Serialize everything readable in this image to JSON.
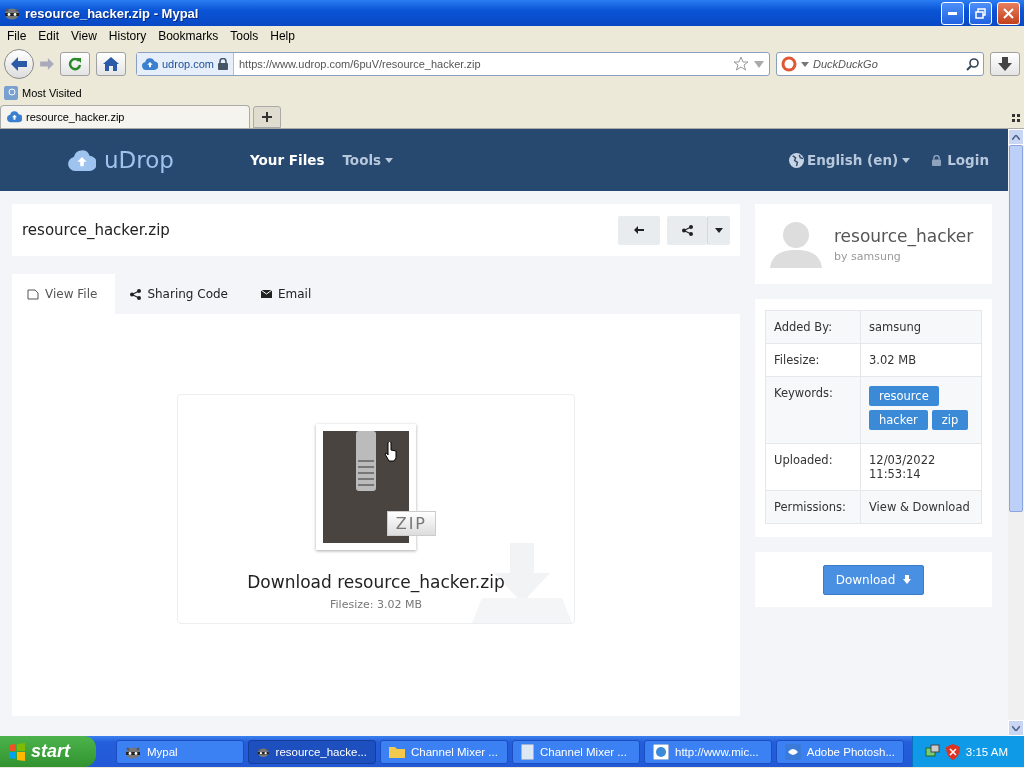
{
  "window": {
    "title": "resource_hacker.zip - Mypal"
  },
  "menu": [
    "File",
    "Edit",
    "View",
    "History",
    "Bookmarks",
    "Tools",
    "Help"
  ],
  "toolbar": {
    "site_identity": "udrop.com",
    "url": "https://www.udrop.com/6puV/resource_hacker.zip",
    "search": {
      "placeholder": "DuckDuckGo"
    }
  },
  "bookmarks": [
    "Most Visited"
  ],
  "tabs": [
    {
      "label": "resource_hacker.zip",
      "selected": true
    }
  ],
  "site_nav": {
    "logo": "uDrop",
    "items": [
      {
        "label": "Your Files",
        "selected": true,
        "dropdown": false
      },
      {
        "label": "Tools",
        "selected": false,
        "dropdown": true
      }
    ],
    "language": "English (en)",
    "login": "Login"
  },
  "file": {
    "title": "resource_hacker.zip",
    "tabs": [
      {
        "label": "View File",
        "kind": "view",
        "selected": true
      },
      {
        "label": "Sharing Code",
        "kind": "share",
        "selected": false
      },
      {
        "label": "Email",
        "kind": "email",
        "selected": false
      }
    ],
    "badge": "ZIP",
    "download_title": "Download resource_hacker.zip",
    "filesize": "Filesize: 3.02 MB"
  },
  "owner": {
    "name": "resource_hacker",
    "by": "by samsung"
  },
  "details": [
    {
      "label": "Added By:",
      "kind": "text",
      "value": "samsung"
    },
    {
      "label": "Filesize:",
      "kind": "text",
      "value": "3.02 MB"
    },
    {
      "label": "Keywords:",
      "kind": "tags",
      "tags": [
        "resource",
        "hacker",
        "zip"
      ]
    },
    {
      "label": "Uploaded:",
      "kind": "text",
      "value": "12/03/2022 11:53:14"
    },
    {
      "label": "Permissions:",
      "kind": "text",
      "value": "View & Download"
    }
  ],
  "download_button": "Download",
  "taskbar": {
    "start": "start",
    "items": [
      {
        "label": "Mypal",
        "kind": "browser",
        "selected": false
      },
      {
        "label": "resource_hacke...",
        "kind": "browser",
        "selected": true
      },
      {
        "label": "Channel Mixer ...",
        "kind": "folder",
        "selected": false
      },
      {
        "label": "Channel Mixer ...",
        "kind": "document",
        "selected": false
      },
      {
        "label": "http://www.mic...",
        "kind": "web",
        "selected": false
      },
      {
        "label": "Adobe Photosh...",
        "kind": "photoshop",
        "selected": false
      }
    ],
    "clock": "3:15 AM"
  }
}
